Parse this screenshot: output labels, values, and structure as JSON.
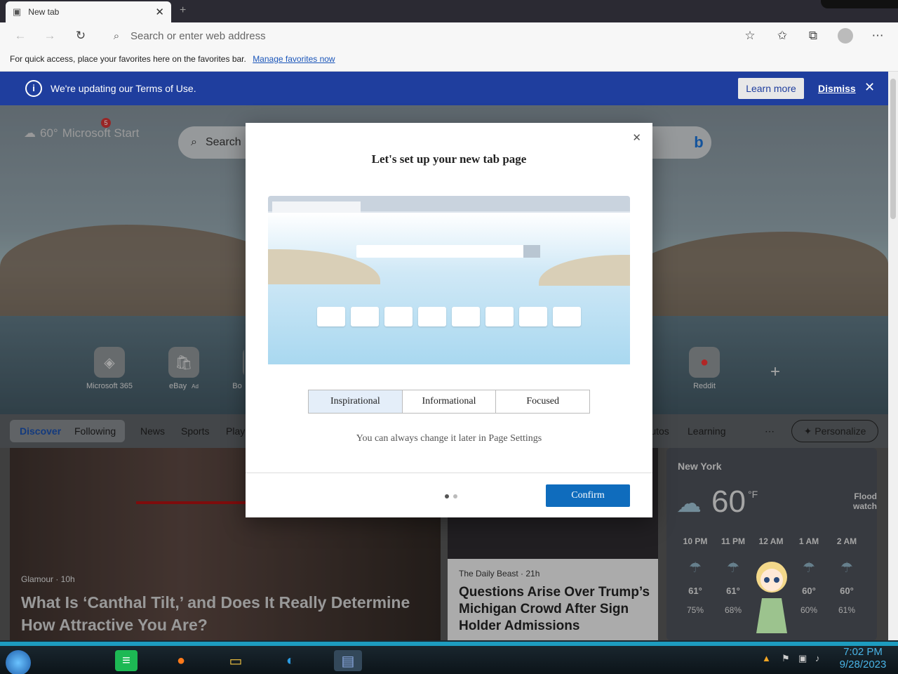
{
  "browser": {
    "tab_title": "New tab",
    "address_placeholder": "Search or enter web address",
    "favbar_text": "For quick access, place your favorites here on the favorites bar.",
    "favbar_link": "Manage favorites now"
  },
  "banner": {
    "message": "We're updating our Terms of Use.",
    "learn_more": "Learn more",
    "dismiss": "Dismiss"
  },
  "hero": {
    "brand": "Microsoft Start",
    "weather_mini": "60°",
    "notification_count": "5",
    "search_placeholder": "Search",
    "tiles": [
      {
        "label": "Microsoft 365"
      },
      {
        "label": "eBay",
        "ad": "Ad"
      },
      {
        "label": "Bo"
      },
      {
        "label": "Reddit"
      }
    ]
  },
  "news_nav": {
    "items": [
      "Discover",
      "Following",
      "News",
      "Sports",
      "Play",
      "Autos",
      "Learning",
      "Personalize"
    ]
  },
  "cards": {
    "card1": {
      "source": "Glamour · 10h",
      "title": "What Is ‘Canthal Tilt,’ and Does It Really Determine How Attractive You Are?"
    },
    "card2": {
      "source": "The Daily Beast · 21h",
      "title": "Questions Arise Over Trump’s Michigan Crowd After Sign Holder Admissions"
    }
  },
  "weather": {
    "city": "New York",
    "temp": "60",
    "unit": "°F",
    "alert": "Flood watch",
    "hours": [
      {
        "time": "10 PM",
        "temp": "61°",
        "precip": "75%"
      },
      {
        "time": "11 PM",
        "temp": "61°",
        "precip": "68%"
      },
      {
        "time": "12 AM",
        "temp": "",
        "precip": ""
      },
      {
        "time": "1 AM",
        "temp": "60°",
        "precip": "60%"
      },
      {
        "time": "2 AM",
        "temp": "60°",
        "precip": "61%"
      }
    ]
  },
  "modal": {
    "title": "Let's set up your new tab page",
    "options": [
      "Inspirational",
      "Informational",
      "Focused"
    ],
    "selected": "Inspirational",
    "hint": "You can always change it later in Page Settings",
    "confirm": "Confirm"
  },
  "taskbar": {
    "time": "7:02 PM",
    "date": "9/28/2023"
  }
}
